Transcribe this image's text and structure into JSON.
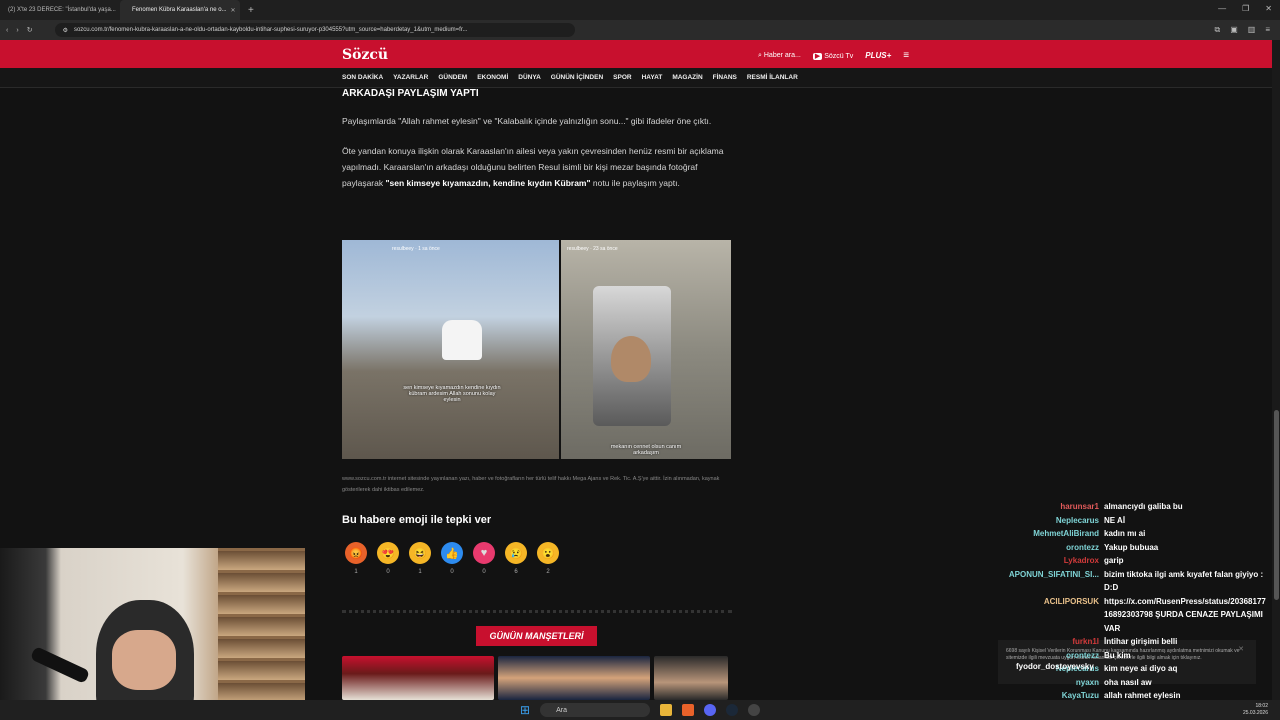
{
  "browser": {
    "tabs": [
      {
        "label": "(2) X'te 23 DERECE: \"İstanbul'da yaşa..."
      },
      {
        "label": "Fenomen Kübra Karaaslan'a ne o..."
      }
    ],
    "url": "sozcu.com.tr/fenomen-kubra-karaaslan-a-ne-oldu-ortadan-kayboldu-intihar-suphesi-suruyor-p304555?utm_source=haberdetay_1&utm_medium=fr..."
  },
  "header": {
    "logo": "Sözcü",
    "search_label": "Haber ara...",
    "tv_label": "Sözcü Tv",
    "plus_label": "PLUS+"
  },
  "nav": [
    "SON DAKİKA",
    "YAZARLAR",
    "GÜNDEM",
    "EKONOMİ",
    "DÜNYA",
    "GÜNÜN İÇİNDEN",
    "SPOR",
    "HAYAT",
    "MAGAZİN",
    "FİNANS",
    "RESMİ İLANLAR"
  ],
  "article": {
    "subhead": "ARKADAŞI PAYLAŞIM YAPTI",
    "para1": "Paylaşımlarda \"Allah rahmet eylesin\" ve \"Kalabalık içinde yalnızlığın sonu...\" gibi ifadeler öne çıktı.",
    "para2_a": "Öte yandan konuya ilişkin olarak Karaaslan'ın ailesi veya yakın çevresinden henüz resmi bir açıklama yapılmadı. Karaarslan'ın arkadaşı olduğunu belirten Resul isimli bir kişi mezar başında fotoğraf paylaşarak ",
    "para2_bold": "\"sen kimseye kıyamazdın, kendine kıydın Kübram\"",
    "para2_b": " notu ile paylaşım yaptı.",
    "story1_user": "resulbeey",
    "story1_time": "1 sa önce",
    "story1_caption": "sen kimseye kıyamazdın kendine kıydın kübram ardesim Allah sonunu kolay eylesin",
    "story2_user": "resulbeey",
    "story2_time": "23 sa önce",
    "story2_caption": "mekanın cennet olsun canım arkadaşım",
    "credit": "www.sozcu.com.tr internet sitesinde yayınlanan yazı, haber ve fotoğrafların her türlü telif hakkı Mega Ajans ve Rek. Tic. A.Ş'ye aittir. İzin alınmadan, kaynak gösterilerek dahi iktibas edilemez.",
    "emoji_title": "Bu habere emoji ile tepki ver",
    "emojis": [
      {
        "icon": "angry",
        "glyph": "😡",
        "count": "1",
        "color": "#e8622a"
      },
      {
        "icon": "love-eyes",
        "glyph": "😍",
        "count": "0",
        "color": "#f5b626"
      },
      {
        "icon": "laugh",
        "glyph": "😆",
        "count": "1",
        "color": "#f5b626"
      },
      {
        "icon": "like",
        "glyph": "👍",
        "count": "0",
        "color": "#2d8bef"
      },
      {
        "icon": "heart",
        "glyph": "♥",
        "count": "0",
        "color": "#e83a6e"
      },
      {
        "icon": "sad",
        "glyph": "😢",
        "count": "6",
        "color": "#f5b626"
      },
      {
        "icon": "wow",
        "glyph": "😮",
        "count": "2",
        "color": "#f5b626"
      }
    ],
    "manset_label": "GÜNÜN MANŞETLERİ"
  },
  "chat": [
    {
      "user": "harunsar1",
      "text": "almancıydı galiba bu",
      "color": "#e05a5a"
    },
    {
      "user": "Neplecarus",
      "text": "NE Aİ",
      "color": "#7fd4d6"
    },
    {
      "user": "MehmetAliBirand",
      "text": "kadın mı ai",
      "color": "#7fd4d6"
    },
    {
      "user": "orontezz",
      "text": "Yakup bubuaa",
      "color": "#7fd4d6"
    },
    {
      "user": "Lykadrox",
      "text": "garip",
      "color": "#d13a3a"
    },
    {
      "user": "APONUN_SIFATINI_SI...",
      "text": "bizim tiktoka ilgi amk kıyafet falan giyiyo :D:D",
      "color": "#7fd4d6"
    },
    {
      "user": "ACILIPORSUK",
      "text": "https://x.com/RusenPress/status/2036817716892303798 ŞURDA CENAZE PAYLAŞIMI VAR",
      "color": "#e8c08a"
    },
    {
      "user": "furkn1l",
      "text": "İntihar girişimi belli",
      "color": "#d13a3a"
    },
    {
      "user": "orontezz",
      "text": "Bu kim",
      "color": "#7fd4d6"
    },
    {
      "user": "Neplecarus",
      "text": "kim neye ai diyo aq",
      "color": "#7fd4d6"
    },
    {
      "user": "nyaxn",
      "text": "oha nasıl aw",
      "color": "#7fd4d6"
    },
    {
      "user": "KayaTuzu",
      "text": "allah rahmet eylesin",
      "color": "#7fd4d6"
    }
  ],
  "cookie": {
    "text": "6698 sayılı Kişisel Verilerin Korunması Kanunu kapsamında hazırlanmış aydınlatma metnimizi okumak ve sitemizde ilgili mevzuata uygun olarak kullanılan çerezlerle ilgili bilgi almak için tıklayınız.",
    "overlay_user": "fyodor_dostoyevsky"
  },
  "taskbar": {
    "search_label": "Ara",
    "time": "18:02",
    "date": "25.03.2026"
  }
}
